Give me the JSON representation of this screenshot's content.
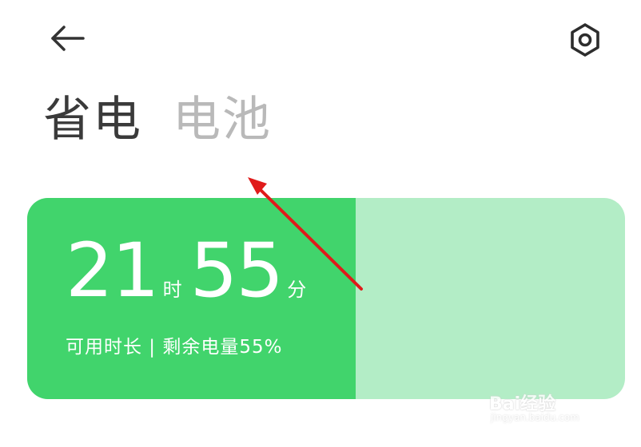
{
  "header": {
    "back_icon": "arrow-left-icon",
    "settings_icon": "hexagon-gear-icon"
  },
  "tabs": [
    {
      "label": "省电",
      "active": true
    },
    {
      "label": "电池",
      "active": false
    }
  ],
  "battery": {
    "hours": "21",
    "hours_unit": "时",
    "minutes": "55",
    "minutes_unit": "分",
    "subtitle": "可用时长 | 剩余电量55%",
    "level_percent": 55,
    "fill_color": "#41d46c",
    "track_color": "#b3edc6"
  },
  "annotation": {
    "arrow_color": "#e01b1b"
  },
  "watermark": {
    "text": "Bai经验",
    "subtext": "jingyan.baidu.com"
  }
}
